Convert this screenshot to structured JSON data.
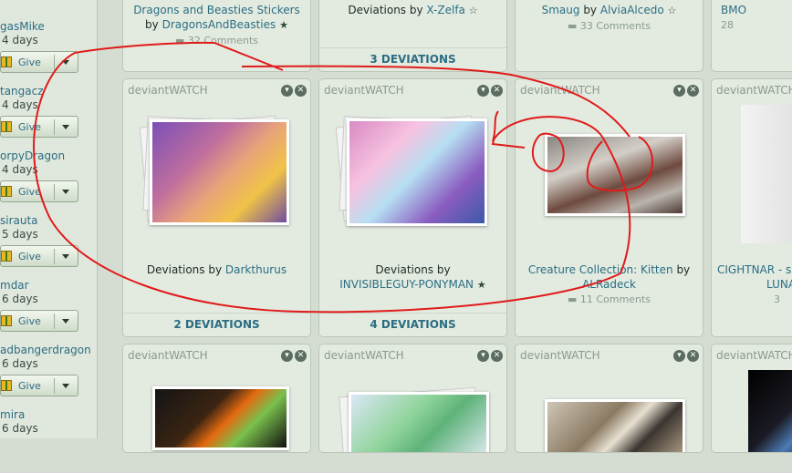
{
  "sidebar": {
    "give_label": "Give",
    "items": [
      {
        "name": "gasMike",
        "days": "4 days"
      },
      {
        "name": "tangacz",
        "days": "4 days"
      },
      {
        "name": "orpyDragon",
        "days": "4 days"
      },
      {
        "name": "sirauta",
        "days": "5 days"
      },
      {
        "name": "mdar",
        "days": "6 days"
      },
      {
        "name": "adbangerdragon",
        "days": "6 days"
      },
      {
        "name": "mira",
        "days": "6 days"
      }
    ]
  },
  "top_cards": [
    {
      "pre": "",
      "title_link": "Dragons and Beasties Stickers",
      "by": "by",
      "author": "DragonsAndBeasties",
      "comments": "32 Comments"
    },
    {
      "pre": "Deviations by",
      "title_link": "",
      "by": "",
      "author": "X-Zelfa",
      "comments": "",
      "footer": "3 DEVIATIONS"
    },
    {
      "pre": "",
      "title_link": "Smaug",
      "by": "by",
      "author": "AlviaAlcedo",
      "comments": "33 Comments"
    },
    {
      "pre": "",
      "title_link": "BMO",
      "by": "",
      "author": "",
      "comments": "28"
    }
  ],
  "card_header": "deviantWATCH",
  "middle_cards": [
    {
      "pre": "Deviations by",
      "author": "Darkthurus",
      "footer": "2 DEVIATIONS"
    },
    {
      "pre": "Deviations by",
      "author": "INVISIBLEGUY-PONYMAN",
      "footer": "4 DEVIATIONS"
    },
    {
      "title_link": "Creature Collection: Kitten",
      "by": "by",
      "author": "ALRadeck",
      "comments": "11 Comments"
    },
    {
      "title_link": "CIGHTNAR - s",
      "author": "LUNA",
      "comments": "3"
    }
  ],
  "bottom_cards": [
    {
      "header": "deviantWATCH"
    },
    {
      "header": "deviantWATCH"
    },
    {
      "header": "deviantWATCH"
    },
    {
      "header": "deviantWATCH"
    }
  ],
  "colors": {
    "link": "#2b6e83",
    "annotation": "#e01b1b"
  }
}
